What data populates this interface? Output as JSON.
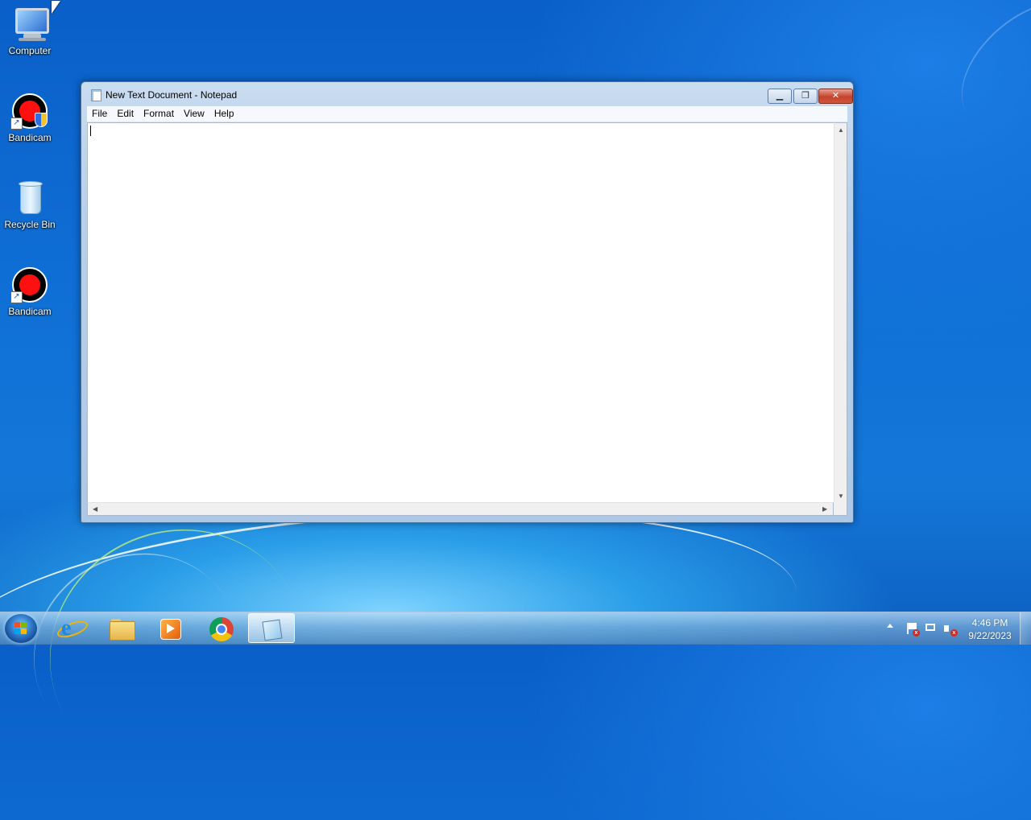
{
  "desktop": {
    "icons": [
      {
        "label": "Computer",
        "icon": "computer-icon"
      },
      {
        "label": "Bandicam",
        "icon": "bandicam-icon"
      },
      {
        "label": "Recycle Bin",
        "icon": "recycle-bin-icon"
      },
      {
        "label": "Bandicam",
        "icon": "bandicam-icon"
      }
    ]
  },
  "window": {
    "title": "New Text Document - Notepad",
    "icon": "notepad-icon",
    "controls": {
      "minimize": "▁",
      "maximize": "❐",
      "close": "✕"
    },
    "menu": [
      "File",
      "Edit",
      "Format",
      "View",
      "Help"
    ],
    "content": ""
  },
  "taskbar": {
    "apps": [
      {
        "name": "internet-explorer-icon",
        "active": false
      },
      {
        "name": "file-explorer-icon",
        "active": false
      },
      {
        "name": "media-player-icon",
        "active": false
      },
      {
        "name": "chrome-icon",
        "active": false
      },
      {
        "name": "notepad-icon",
        "active": true
      }
    ],
    "tray": {
      "icons": [
        "show-hidden-icons-arrow",
        "action-center-flag-icon",
        "network-icon",
        "volume-muted-icon"
      ]
    },
    "clock": {
      "time": "4:46 PM",
      "date": "9/22/2023"
    }
  },
  "colors": {
    "close_button": "#c4432c",
    "desktop": "#0f6fd6"
  }
}
